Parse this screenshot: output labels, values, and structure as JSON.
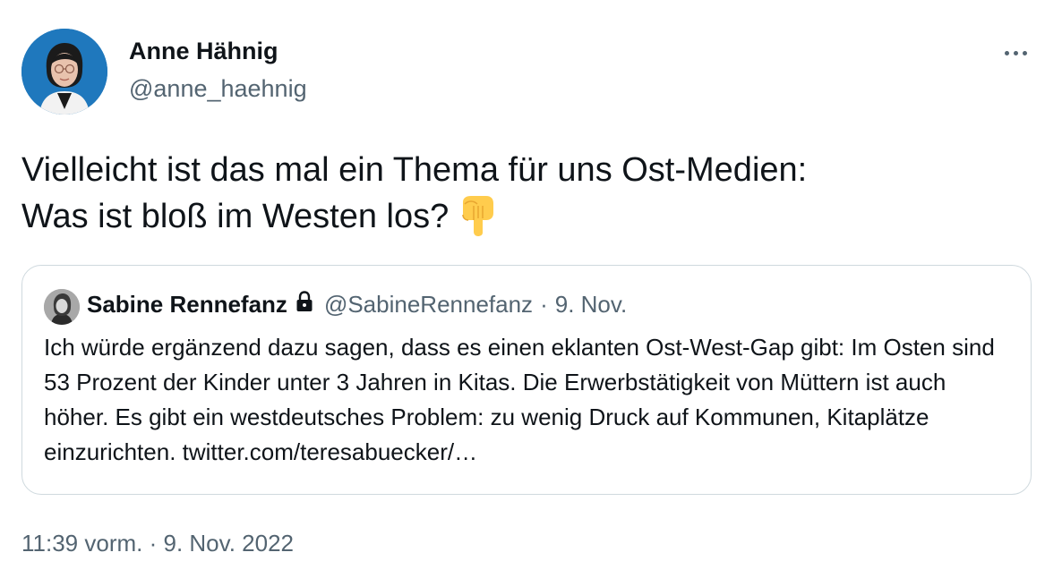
{
  "author": {
    "name": "Anne Hähnig",
    "handle": "@anne_haehnig"
  },
  "tweet": {
    "line1": "Vielleicht ist das mal ein Thema für uns Ost-Medien:",
    "line2": "Was ist bloß im Westen los?",
    "emoji": "backhand-index-pointing-down"
  },
  "quote": {
    "name": "Sabine Rennefanz",
    "handle": "@SabineRennefanz",
    "separator": "·",
    "date": "9. Nov.",
    "text": "Ich würde ergänzend dazu sagen, dass es einen eklanten Ost-West-Gap gibt: Im Osten sind 53 Prozent der Kinder unter 3 Jahren in Kitas. Die Erwerbstätigkeit von Müttern ist auch höher. Es gibt ein westdeutsches Problem: zu wenig Druck auf Kommunen, Kitaplätze einzurichten. twitter.com/teresabuecker/…"
  },
  "meta": {
    "time": "11:39 vorm.",
    "separator": "·",
    "date": "9. Nov. 2022"
  },
  "icons": {
    "more": "more-horizontal-icon",
    "lock": "lock-icon"
  },
  "colors": {
    "text_primary": "#0f1419",
    "text_secondary": "#536471",
    "border": "#cfd9de"
  }
}
